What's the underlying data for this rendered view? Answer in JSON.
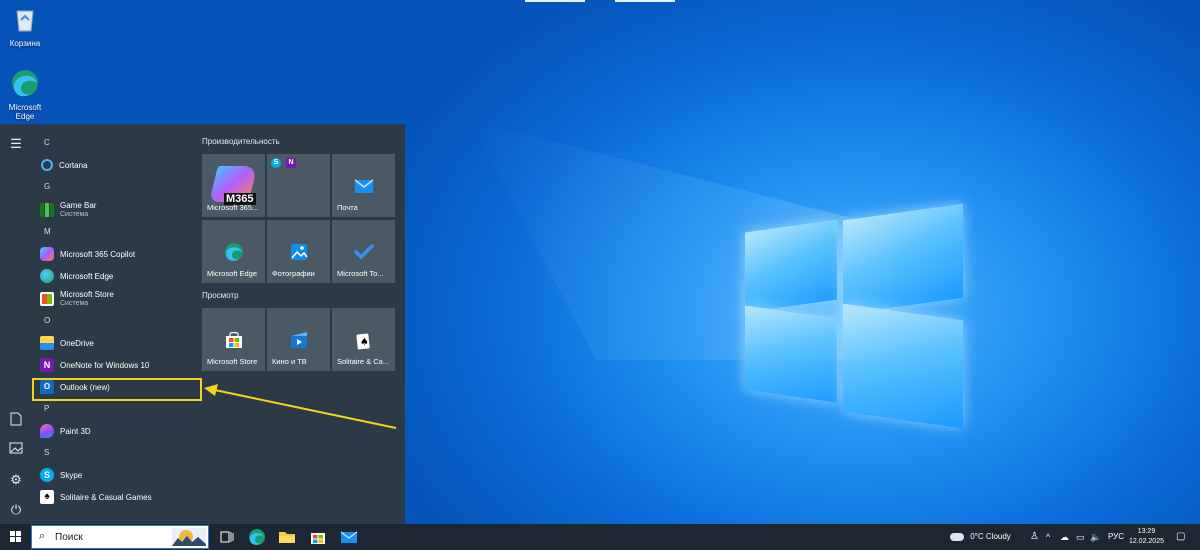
{
  "desktop": {
    "icons": [
      {
        "label": "Корзина"
      },
      {
        "label": "Microsoft Edge"
      }
    ]
  },
  "start_menu": {
    "app_list": [
      {
        "type": "letter",
        "label": "C"
      },
      {
        "type": "app",
        "label": "Cortana",
        "icon": "cortana-icon"
      },
      {
        "type": "letter",
        "label": "G"
      },
      {
        "type": "app",
        "label": "Game Bar",
        "sub": "Система",
        "icon": "game-bar-icon"
      },
      {
        "type": "letter",
        "label": "M"
      },
      {
        "type": "app",
        "label": "Microsoft 365 Copilot",
        "icon": "m365-copilot-icon"
      },
      {
        "type": "app",
        "label": "Microsoft Edge",
        "icon": "edge-icon"
      },
      {
        "type": "app",
        "label": "Microsoft Store",
        "sub": "Система",
        "icon": "store-icon"
      },
      {
        "type": "letter",
        "label": "O"
      },
      {
        "type": "app",
        "label": "OneDrive",
        "icon": "onedrive-icon"
      },
      {
        "type": "app",
        "label": "OneNote for Windows 10",
        "icon": "onenote-icon"
      },
      {
        "type": "app",
        "label": "Outlook (new)",
        "icon": "outlook-icon"
      },
      {
        "type": "letter",
        "label": "P"
      },
      {
        "type": "app",
        "label": "Paint 3D",
        "icon": "paint3d-icon"
      },
      {
        "type": "letter",
        "label": "S"
      },
      {
        "type": "app",
        "label": "Skype",
        "icon": "skype-icon"
      },
      {
        "type": "app",
        "label": "Solitaire & Casual Games",
        "icon": "solitaire-icon"
      }
    ],
    "groups": [
      {
        "title": "Производительность"
      },
      {
        "title": "Просмотр"
      }
    ],
    "tiles": {
      "m365": "Microsoft 365...",
      "m365_badge": "M365",
      "mail": "Почта",
      "edge": "Microsoft Edge",
      "photos": "Фотографии",
      "todo": "Microsoft To...",
      "store": "Microsoft Store",
      "movies": "Кино и ТВ",
      "solitaire": "Solitaire & Ca..."
    }
  },
  "taskbar": {
    "search_placeholder": "Поиск",
    "weather": "0°C  Cloudy",
    "language": "РУС",
    "time": "13:29",
    "date": "12.02.2025"
  },
  "colors": {
    "highlight": "#f3d41a",
    "start_bg": "#2b3a46",
    "tile_bg": "#4a5964"
  }
}
